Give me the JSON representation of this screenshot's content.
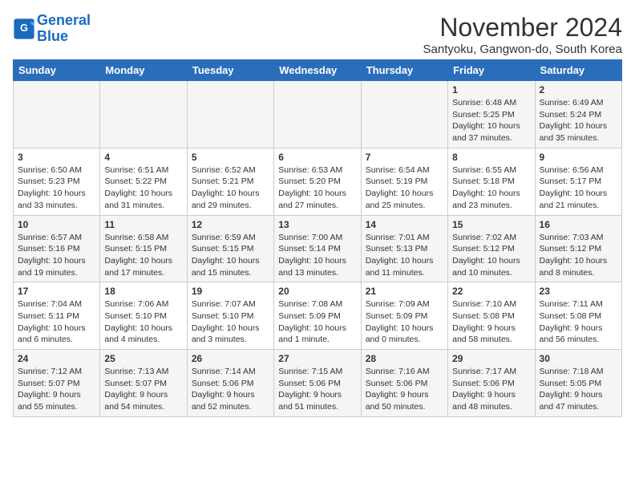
{
  "logo": {
    "line1": "General",
    "line2": "Blue"
  },
  "title": "November 2024",
  "subtitle": "Santyoku, Gangwon-do, South Korea",
  "days_header": [
    "Sunday",
    "Monday",
    "Tuesday",
    "Wednesday",
    "Thursday",
    "Friday",
    "Saturday"
  ],
  "weeks": [
    [
      {
        "day": "",
        "info": ""
      },
      {
        "day": "",
        "info": ""
      },
      {
        "day": "",
        "info": ""
      },
      {
        "day": "",
        "info": ""
      },
      {
        "day": "",
        "info": ""
      },
      {
        "day": "1",
        "info": "Sunrise: 6:48 AM\nSunset: 5:25 PM\nDaylight: 10 hours and 37 minutes."
      },
      {
        "day": "2",
        "info": "Sunrise: 6:49 AM\nSunset: 5:24 PM\nDaylight: 10 hours and 35 minutes."
      }
    ],
    [
      {
        "day": "3",
        "info": "Sunrise: 6:50 AM\nSunset: 5:23 PM\nDaylight: 10 hours and 33 minutes."
      },
      {
        "day": "4",
        "info": "Sunrise: 6:51 AM\nSunset: 5:22 PM\nDaylight: 10 hours and 31 minutes."
      },
      {
        "day": "5",
        "info": "Sunrise: 6:52 AM\nSunset: 5:21 PM\nDaylight: 10 hours and 29 minutes."
      },
      {
        "day": "6",
        "info": "Sunrise: 6:53 AM\nSunset: 5:20 PM\nDaylight: 10 hours and 27 minutes."
      },
      {
        "day": "7",
        "info": "Sunrise: 6:54 AM\nSunset: 5:19 PM\nDaylight: 10 hours and 25 minutes."
      },
      {
        "day": "8",
        "info": "Sunrise: 6:55 AM\nSunset: 5:18 PM\nDaylight: 10 hours and 23 minutes."
      },
      {
        "day": "9",
        "info": "Sunrise: 6:56 AM\nSunset: 5:17 PM\nDaylight: 10 hours and 21 minutes."
      }
    ],
    [
      {
        "day": "10",
        "info": "Sunrise: 6:57 AM\nSunset: 5:16 PM\nDaylight: 10 hours and 19 minutes."
      },
      {
        "day": "11",
        "info": "Sunrise: 6:58 AM\nSunset: 5:15 PM\nDaylight: 10 hours and 17 minutes."
      },
      {
        "day": "12",
        "info": "Sunrise: 6:59 AM\nSunset: 5:15 PM\nDaylight: 10 hours and 15 minutes."
      },
      {
        "day": "13",
        "info": "Sunrise: 7:00 AM\nSunset: 5:14 PM\nDaylight: 10 hours and 13 minutes."
      },
      {
        "day": "14",
        "info": "Sunrise: 7:01 AM\nSunset: 5:13 PM\nDaylight: 10 hours and 11 minutes."
      },
      {
        "day": "15",
        "info": "Sunrise: 7:02 AM\nSunset: 5:12 PM\nDaylight: 10 hours and 10 minutes."
      },
      {
        "day": "16",
        "info": "Sunrise: 7:03 AM\nSunset: 5:12 PM\nDaylight: 10 hours and 8 minutes."
      }
    ],
    [
      {
        "day": "17",
        "info": "Sunrise: 7:04 AM\nSunset: 5:11 PM\nDaylight: 10 hours and 6 minutes."
      },
      {
        "day": "18",
        "info": "Sunrise: 7:06 AM\nSunset: 5:10 PM\nDaylight: 10 hours and 4 minutes."
      },
      {
        "day": "19",
        "info": "Sunrise: 7:07 AM\nSunset: 5:10 PM\nDaylight: 10 hours and 3 minutes."
      },
      {
        "day": "20",
        "info": "Sunrise: 7:08 AM\nSunset: 5:09 PM\nDaylight: 10 hours and 1 minute."
      },
      {
        "day": "21",
        "info": "Sunrise: 7:09 AM\nSunset: 5:09 PM\nDaylight: 10 hours and 0 minutes."
      },
      {
        "day": "22",
        "info": "Sunrise: 7:10 AM\nSunset: 5:08 PM\nDaylight: 9 hours and 58 minutes."
      },
      {
        "day": "23",
        "info": "Sunrise: 7:11 AM\nSunset: 5:08 PM\nDaylight: 9 hours and 56 minutes."
      }
    ],
    [
      {
        "day": "24",
        "info": "Sunrise: 7:12 AM\nSunset: 5:07 PM\nDaylight: 9 hours and 55 minutes."
      },
      {
        "day": "25",
        "info": "Sunrise: 7:13 AM\nSunset: 5:07 PM\nDaylight: 9 hours and 54 minutes."
      },
      {
        "day": "26",
        "info": "Sunrise: 7:14 AM\nSunset: 5:06 PM\nDaylight: 9 hours and 52 minutes."
      },
      {
        "day": "27",
        "info": "Sunrise: 7:15 AM\nSunset: 5:06 PM\nDaylight: 9 hours and 51 minutes."
      },
      {
        "day": "28",
        "info": "Sunrise: 7:16 AM\nSunset: 5:06 PM\nDaylight: 9 hours and 50 minutes."
      },
      {
        "day": "29",
        "info": "Sunrise: 7:17 AM\nSunset: 5:06 PM\nDaylight: 9 hours and 48 minutes."
      },
      {
        "day": "30",
        "info": "Sunrise: 7:18 AM\nSunset: 5:05 PM\nDaylight: 9 hours and 47 minutes."
      }
    ]
  ]
}
